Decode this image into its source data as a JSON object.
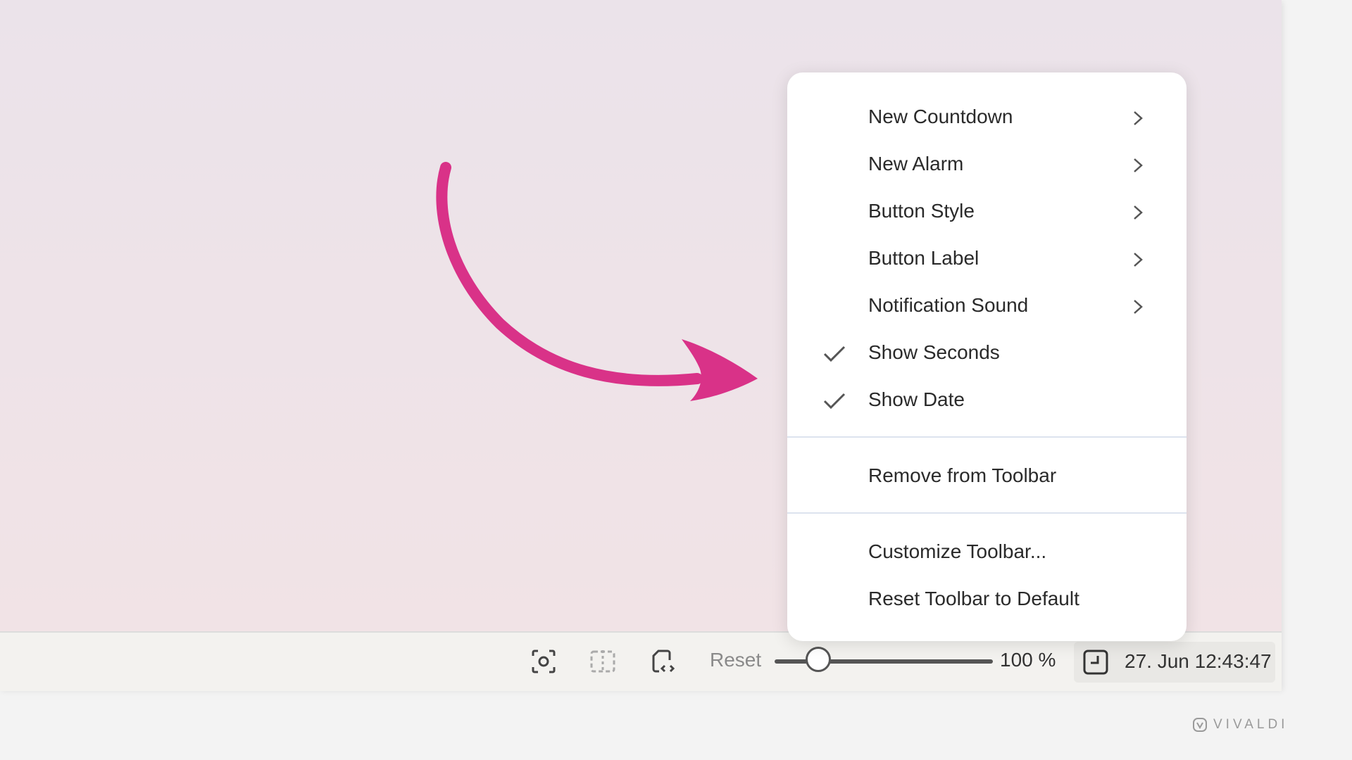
{
  "menu": {
    "items": [
      {
        "label": "New Countdown",
        "submenu": true,
        "checked": false
      },
      {
        "label": "New Alarm",
        "submenu": true,
        "checked": false
      },
      {
        "label": "Button Style",
        "submenu": true,
        "checked": false
      },
      {
        "label": "Button Label",
        "submenu": true,
        "checked": false
      },
      {
        "label": "Notification Sound",
        "submenu": true,
        "checked": false
      },
      {
        "label": "Show Seconds",
        "submenu": false,
        "checked": true
      },
      {
        "label": "Show Date",
        "submenu": false,
        "checked": true
      }
    ],
    "remove": "Remove from Toolbar",
    "customize": "Customize Toolbar...",
    "reset_default": "Reset Toolbar to Default"
  },
  "statusbar": {
    "icons": [
      "capture-icon",
      "tiling-icon",
      "page-actions-icon"
    ],
    "reset_label": "Reset",
    "zoom_label": "100 %",
    "zoom_level_fraction": 0.2,
    "clock_text": "27. Jun 12:43:47",
    "clock_icon": "clock-icon"
  },
  "annotation": {
    "arrow_color": "#d93288"
  },
  "watermark": {
    "text": "VIVALDI",
    "icon": "vivaldi-logo-icon"
  },
  "colors": {
    "page_gradient_top": "#ebe3ea",
    "page_gradient_bottom": "#f1e3e6",
    "menu_background": "#ffffff",
    "separator": "#dde3ee"
  }
}
